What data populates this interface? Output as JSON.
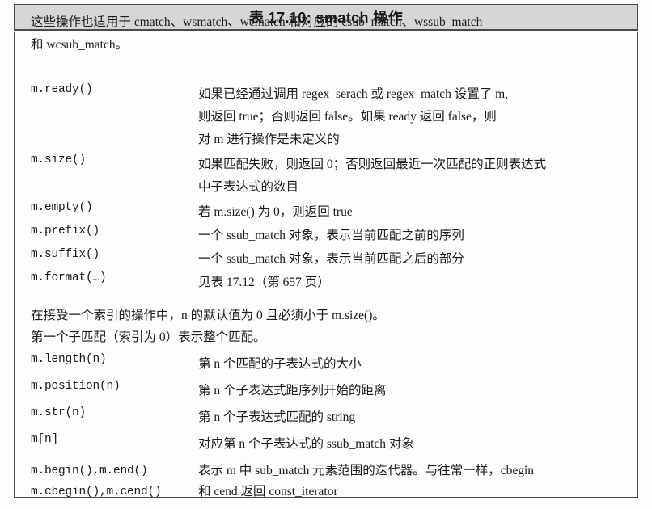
{
  "caption": {
    "label": "表 17.10: smatch 操作"
  },
  "intro": {
    "line1": "这些操作也适用于 cmatch、wsmatch、wcmatch 和对应的 csub_match、wssub_match",
    "line2": "和 wcsub_match。"
  },
  "rows": [
    {
      "op": "m.ready()",
      "desc_line1": "如果已经通过调用 regex_serach 或 regex_match 设置了 m,",
      "desc_line2": "则返回 true；否则返回 false。如果 ready 返回 false，则",
      "desc_line3": "对 m 进行操作是未定义的"
    },
    {
      "op": "m.size()",
      "desc_line1": "如果匹配失败，则返回 0；否则返回最近一次匹配的正则表达式",
      "desc_line2": "中子表达式的数目"
    },
    {
      "op": "m.empty()",
      "desc_line1": "若 m.size() 为 0，则返回 true"
    },
    {
      "op": "m.prefix()",
      "desc_line1": "一个 ssub_match 对象，表示当前匹配之前的序列"
    },
    {
      "op": "m.suffix()",
      "desc_line1": "一个 ssub_match 对象，表示当前匹配之后的部分"
    },
    {
      "op": "m.format(…)",
      "desc_line1": "见表 17.12（第 657 页）"
    }
  ],
  "notes": {
    "line1": "在接受一个索引的操作中，n 的默认值为 0 且必须小于 m.size()。",
    "line2": "第一个子匹配（索引为 0）表示整个匹配。"
  },
  "rows2": [
    {
      "op": "m.length(n)",
      "desc_line1": "第 n 个匹配的子表达式的大小"
    },
    {
      "op": "m.position(n)",
      "desc_line1": "第 n 个子表达式距序列开始的距离"
    },
    {
      "op": "m.str(n)",
      "desc_line1": "第 n 个子表达式匹配的 string"
    },
    {
      "op": "m[n]",
      "desc_line1": "对应第 n 个子表达式的 ssub_match 对象"
    }
  ],
  "iterator_row": {
    "op_line1": "m.begin(),m.end()",
    "op_line2": "m.cbegin(),m.cend()",
    "desc_line1": "表示 m 中 sub_match 元素范围的迭代器。与往常一样，cbegin",
    "desc_line2": "和 cend 返回 const_iterator"
  }
}
